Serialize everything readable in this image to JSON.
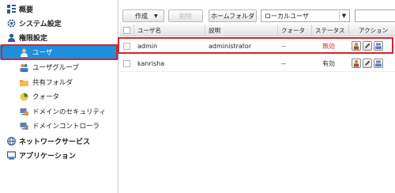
{
  "sidebar": {
    "items": [
      {
        "label": "概要",
        "icon": "overview-icon",
        "level": 0,
        "active": false
      },
      {
        "label": "システム設定",
        "icon": "gear-icon",
        "level": 0,
        "active": false
      },
      {
        "label": "権限設定",
        "icon": "user-icon",
        "level": 0,
        "active": false
      },
      {
        "label": "ユーザ",
        "icon": "user-icon",
        "level": 1,
        "active": true
      },
      {
        "label": "ユーザグループ",
        "icon": "user-group-icon",
        "level": 1,
        "active": false
      },
      {
        "label": "共有フォルダ",
        "icon": "folder-icon",
        "level": 1,
        "active": false
      },
      {
        "label": "クォータ",
        "icon": "quota-icon",
        "level": 1,
        "active": false
      },
      {
        "label": "ドメインのセキュリティ",
        "icon": "domain-security-icon",
        "level": 1,
        "active": false
      },
      {
        "label": "ドメインコントローラ",
        "icon": "domain-controller-icon",
        "level": 1,
        "active": false
      },
      {
        "label": "ネットワークサービス",
        "icon": "network-icon",
        "level": 0,
        "active": false
      },
      {
        "label": "アプリケーション",
        "icon": "application-icon",
        "level": 0,
        "active": false
      }
    ]
  },
  "toolbar": {
    "create_label": "作成",
    "delete_label": "削除",
    "home_folder_label": "ホームフォルダ",
    "user_type_selected": "ローカルユーザ"
  },
  "table": {
    "headers": [
      "ユーザ名",
      "説明",
      "クォータ",
      "ステータス",
      "アクション"
    ],
    "rows": [
      {
        "username": "admin",
        "description": "administrator",
        "quota": "--",
        "status": "無効",
        "status_color": "#e0232a"
      },
      {
        "username": "kanrisha",
        "description": "",
        "quota": "--",
        "status": "有効",
        "status_color": "#333333"
      }
    ]
  },
  "colors": {
    "accent": "#1e8fdd",
    "highlight": "#d6262d"
  }
}
